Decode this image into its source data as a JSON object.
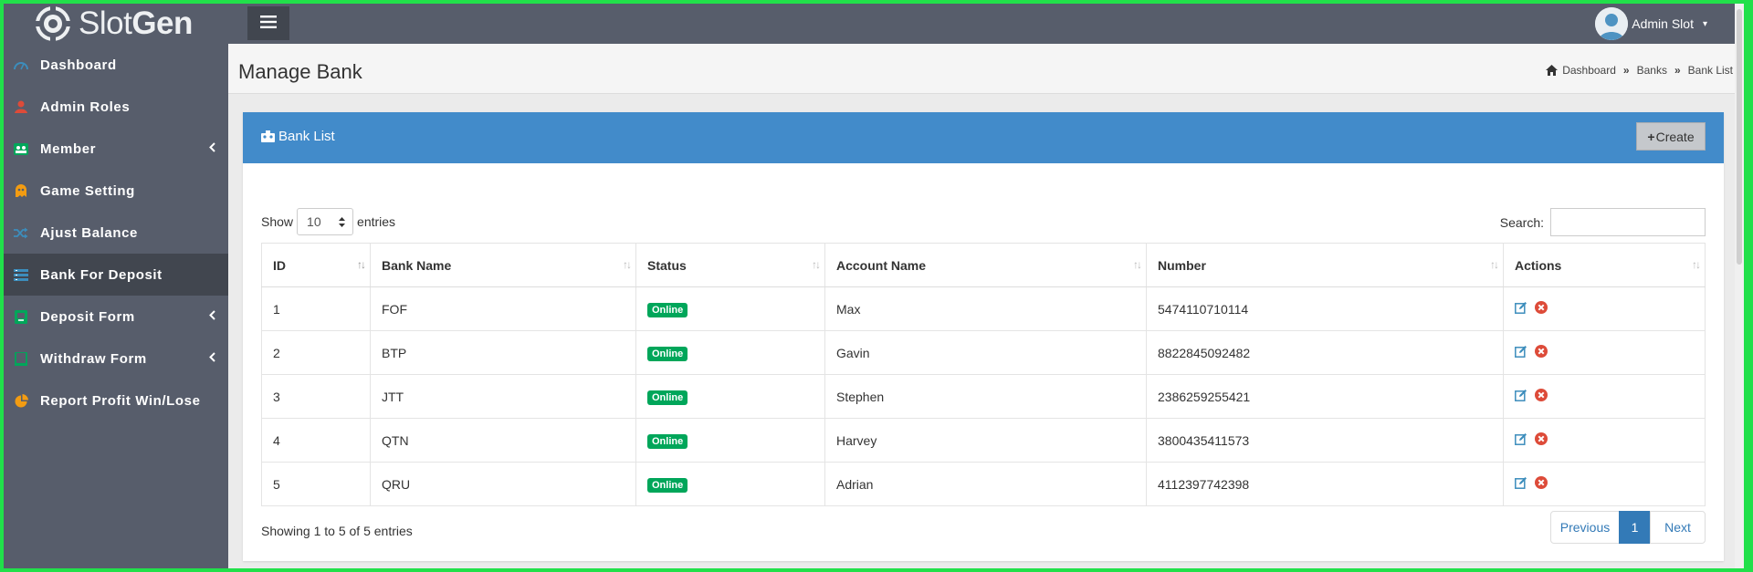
{
  "app": {
    "logo_text_light": "Slot",
    "logo_text_bold": "Gen"
  },
  "topbar": {
    "user_name": "Admin Slot",
    "menu_icon": "hamburger-icon",
    "caret": "▾"
  },
  "sidebar": {
    "items": [
      {
        "label": "Dashboard",
        "icon": "dashboard-icon",
        "color": "#3c8dbc",
        "has_children": false,
        "active": false
      },
      {
        "label": "Admin Roles",
        "icon": "user-icon",
        "color": "#dd4b39",
        "has_children": false,
        "active": false
      },
      {
        "label": "Member",
        "icon": "users-icon",
        "color": "#00a65a",
        "has_children": true,
        "active": false
      },
      {
        "label": "Game Setting",
        "icon": "gamepad-icon",
        "color": "#f39c12",
        "has_children": false,
        "active": false
      },
      {
        "label": "Ajust Balance",
        "icon": "shuffle-icon",
        "color": "#3c8dbc",
        "has_children": false,
        "active": false
      },
      {
        "label": "Bank For Deposit",
        "icon": "bank-list-icon",
        "color": "#3c8dbc",
        "has_children": false,
        "active": true
      },
      {
        "label": "Deposit Form",
        "icon": "deposit-icon",
        "color": "#00a65a",
        "has_children": true,
        "active": false
      },
      {
        "label": "Withdraw Form",
        "icon": "withdraw-icon",
        "color": "#00a65a",
        "has_children": true,
        "active": false
      },
      {
        "label": "Report Profit Win/Lose",
        "icon": "pie-chart-icon",
        "color": "#f39c12",
        "has_children": false,
        "active": false
      }
    ]
  },
  "header": {
    "title": "Manage Bank",
    "breadcrumb": [
      "Dashboard",
      "Banks",
      "Bank List"
    ],
    "breadcrumb_sep": "»"
  },
  "box": {
    "title": "Bank List",
    "create_label": "Create",
    "create_prefix": "+",
    "accent": "#428bca"
  },
  "table_controls": {
    "show_label": "Show",
    "entries_label": "entries",
    "page_length": "10",
    "search_label": "Search:",
    "search_value": ""
  },
  "table": {
    "columns": [
      "ID",
      "Bank Name",
      "Status",
      "Account Name",
      "Number",
      "Actions"
    ],
    "rows": [
      {
        "id": "1",
        "bank": "FOF",
        "status": "Online",
        "account": "Max",
        "number": "5474110710114"
      },
      {
        "id": "2",
        "bank": "BTP",
        "status": "Online",
        "account": "Gavin",
        "number": "8822845092482"
      },
      {
        "id": "3",
        "bank": "JTT",
        "status": "Online",
        "account": "Stephen",
        "number": "2386259255421"
      },
      {
        "id": "4",
        "bank": "QTN",
        "status": "Online",
        "account": "Harvey",
        "number": "3800435411573"
      },
      {
        "id": "5",
        "bank": "QRU",
        "status": "Online",
        "account": "Adrian",
        "number": "4112397742398"
      }
    ],
    "status_color": "#00a65a",
    "edit_icon": "edit-icon",
    "delete_icon": "delete-icon"
  },
  "footer": {
    "info": "Showing 1 to 5 of 5 entries",
    "prev_label": "Previous",
    "current_page": "1",
    "next_label": "Next"
  }
}
